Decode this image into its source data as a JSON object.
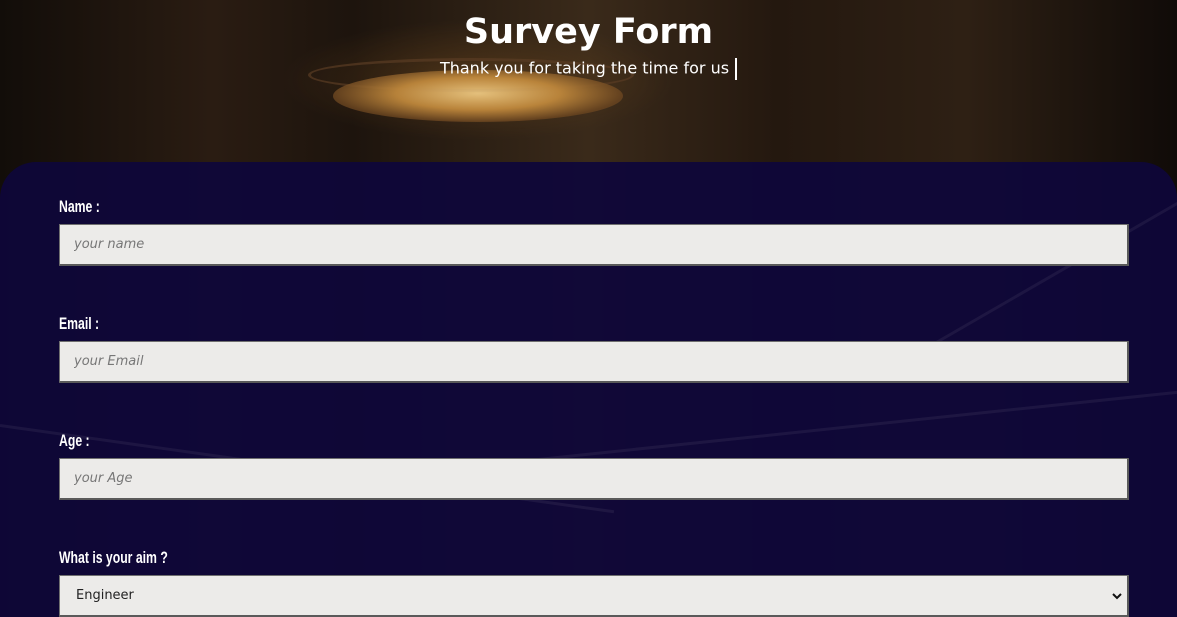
{
  "header": {
    "title": "Survey Form",
    "subtitle": "Thank you for taking the time for us"
  },
  "form": {
    "name": {
      "label": "Name :",
      "placeholder": "your name",
      "value": ""
    },
    "email": {
      "label": "Email :",
      "placeholder": "your Email",
      "value": ""
    },
    "age": {
      "label": "Age :",
      "placeholder": "your Age",
      "value": ""
    },
    "aim": {
      "label": "What is your aim ?",
      "selected": "Engineer"
    }
  },
  "colors": {
    "panel": "#0e063a",
    "input_bg": "#ecebe9",
    "text": "#ffffff"
  },
  "icons": {
    "select_chevron": "chevron-down-icon"
  }
}
